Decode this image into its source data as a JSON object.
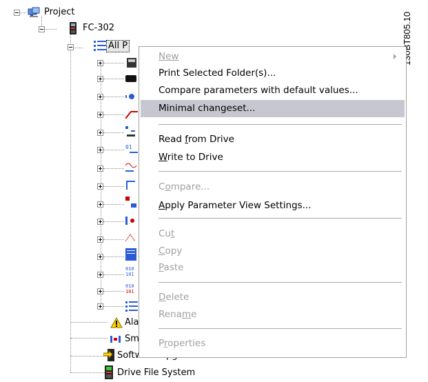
{
  "doc_id": "130BT805.10",
  "tree": {
    "project_label": "Project",
    "fc_label": "FC-302",
    "all_params_label": "All P",
    "alarm_label": "Alar",
    "smart_label": "Sma",
    "software_upgrader_label": "Software Upgrader",
    "drive_file_system_label": "Drive File System"
  },
  "menu": {
    "new": "New",
    "print_selected": "Print Selected Folder(s)...",
    "compare_default": "Compare parameters with default values...",
    "minimal_changeset": "Minimal changeset...",
    "read_from_drive_pre": "Read ",
    "read_from_drive_u": "f",
    "read_from_drive_post": "rom Drive",
    "write_to_drive_u": "W",
    "write_to_drive_post": "rite to Drive",
    "compare_pre": "C",
    "compare_u": "o",
    "compare_post": "mpare...",
    "apply_u": "A",
    "apply_post": "pply Parameter View Settings...",
    "cut_pre": "Cu",
    "cut_u": "t",
    "copy_u": "C",
    "copy_post": "opy",
    "paste_u": "P",
    "paste_post": "aste",
    "delete_u": "D",
    "delete_post": "elete",
    "rename_pre": "Rena",
    "rename_u": "m",
    "rename_post": "e",
    "properties_pre": "P",
    "properties_u": "r",
    "properties_post": "operties"
  }
}
